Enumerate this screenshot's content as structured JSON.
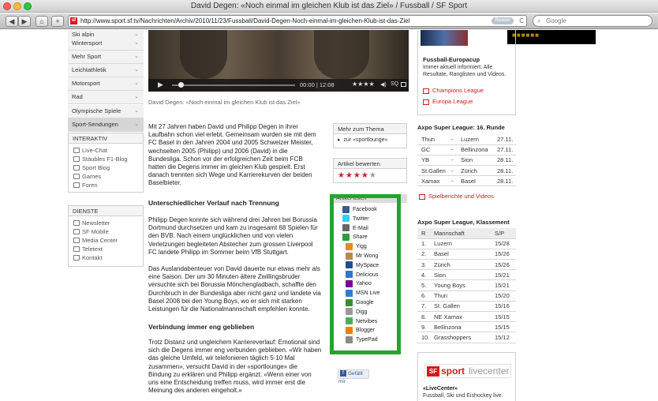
{
  "window": {
    "title": "David Degen: «Noch einmal im gleichen Klub ist das Ziel» / Fussball / SF Sport"
  },
  "toolbar": {
    "back_label": "◀",
    "forward_label": "▶",
    "home_label": "⌂",
    "add_label": "+",
    "url": "http://www.sport.sf.tv/Nachrichten/Archiv/2010/11/23/Fussball/David-Degen-Noch-einmal-im-gleichen-Klub-ist-das-Ziel",
    "reader_label": "Reader",
    "reload_label": "C",
    "search_placeholder": "Google"
  },
  "sidebar": {
    "sports": [
      "Ski alpin",
      "Wintersport",
      "Mehr Sport",
      "Leichtathletik",
      "Motorsport",
      "Rad",
      "Olympische Spiele",
      "Sport-Sendungen"
    ],
    "interaktiv_title": "INTERAKTIV",
    "interaktiv": [
      {
        "label": "Live-Chat",
        "icon": "chat-icon"
      },
      {
        "label": "Stäubles F1-Blog",
        "icon": "blog-icon"
      },
      {
        "label": "Sport Blog",
        "icon": "blog-icon"
      },
      {
        "label": "Games",
        "icon": "games-icon"
      },
      {
        "label": "Foren",
        "icon": "forum-icon"
      }
    ],
    "dienste_title": "DIENSTE",
    "dienste": [
      {
        "label": "Newsletter",
        "icon": "newsletter-icon"
      },
      {
        "label": "SF Mobile",
        "icon": "mobile-icon"
      },
      {
        "label": "Media Center",
        "icon": "media-icon"
      },
      {
        "label": "Teletext",
        "icon": "teletext-icon"
      },
      {
        "label": "Kontakt",
        "icon": "mail-icon"
      }
    ]
  },
  "video": {
    "time": "00:00 | 12:08",
    "rating": "★★★★",
    "sq_label": "SQ",
    "caption": "David Degen: «Noch einmal im gleichen Klub ist das Ziel»"
  },
  "article": {
    "p1": "Mit 27 Jahren haben David und Philipp Degen in ihrer Laufbahn schon viel erlebt. Gemeinsam wurden sie mit dem FC Basel in den Jahren 2004 und 2005 Schweizer Meister, wechselten 2005 (Philipp) und 2006 (David) in die Bundesliga. Schon vor der erfolgreichen Zeit beim FCB hatten die Degens immer im gleichen Klub gespielt. Erst danach trennten sich Wege und Karrierekurven der beiden Baselbieter.",
    "h2a": "Unterschiedlicher Verlauf nach Trennung",
    "p2": "Philipp Degen konnte sich während drei Jahren bei Borussia Dortmund durchsetzen und kam zu insgesamt 68 Spielen für den BVB. Nach einem unglücklichen und von vielen Verletzungen begleiteten Abstecher zum grossen Liverpool FC landete Philipp im Sommer beim VfB Stuttgart.",
    "p3": "Das Auslandabenteuer von David dauerte nur etwas mehr als eine Saison. Der um 30 Minuten ältere Zwillingsbruder versuchte sich bei Borussia Mönchengladbach, schaffte den Durchbruch in der Bundesliga aber nicht ganz und landete via Basel 2008 bei den Young Boys, wo er sich mit starken Leistungen für die Nationalmannschaft empfehlen konnte.",
    "h2b": "Verbindung immer eng geblieben",
    "p4": "Trotz Distanz und ungleichem Karriereverlauf: Emotional sind sich die Degens immer eng verbunden geblieben. «Wir haben das gleiche Umfeld, wir telefonieren täglich 5-10 Mal zusammen», versucht David in der «sportlounge» die Bindung zu erklären und Philipp ergänzt: «Wenn einer von uns eine Entscheidung treffen muss, wird immer erst die Meinung des anderen eingeholt.»"
  },
  "mid": {
    "thema_title": "Mehr zum Thema",
    "thema_link": "zur «sportlounge»",
    "bewerten_title": "Artikel bewerten",
    "stars": "★★★★",
    "star_empty": "★",
    "teilen_title": "Artikel teilen",
    "share": [
      {
        "label": "Facebook",
        "icon": "facebook-icon",
        "color": "#3b5998"
      },
      {
        "label": "Twitter",
        "icon": "twitter-icon",
        "color": "#33ccff"
      },
      {
        "label": "E-Mail",
        "icon": "email-icon",
        "color": "#666666"
      },
      {
        "label": "Share",
        "icon": "share-icon",
        "color": "#2a9d3a"
      },
      {
        "label": "Yigg",
        "icon": "yigg-icon",
        "color": "#e58a1f"
      },
      {
        "label": "Mr Wong",
        "icon": "mrwong-icon",
        "color": "#b38b4d"
      },
      {
        "label": "MySpace",
        "icon": "myspace-icon",
        "color": "#1d4f91"
      },
      {
        "label": "Delicious",
        "icon": "delicious-icon",
        "color": "#3274d1"
      },
      {
        "label": "Yahoo",
        "icon": "yahoo-icon",
        "color": "#7b0099"
      },
      {
        "label": "MSN Live",
        "icon": "msn-icon",
        "color": "#2a7fd4"
      },
      {
        "label": "Google",
        "icon": "google-icon",
        "color": "#3c8d2f"
      },
      {
        "label": "Digg",
        "icon": "digg-icon",
        "color": "#9a9a9a"
      },
      {
        "label": "Netvibes",
        "icon": "netvibes-icon",
        "color": "#4caf50"
      },
      {
        "label": "Blogger",
        "icon": "blogger-icon",
        "color": "#f57d00"
      },
      {
        "label": "TypePad",
        "icon": "typepad-icon",
        "color": "#8a8a8a"
      }
    ],
    "highlight_color": "#22a52a",
    "like_label": "Gefällt mir"
  },
  "right": {
    "europa_title": "Fussball-Europacup",
    "europa_text": "Immer aktuell informiert: Alle Resultate, Ranglisten und Videos.",
    "links": [
      "Champions League",
      "Europa League"
    ],
    "round_title": "Axpo Super League: 16. Runde",
    "fixtures": [
      {
        "home": "Thun",
        "sep": "-",
        "away": "Luzern",
        "date": "27.11."
      },
      {
        "home": "GC",
        "sep": "-",
        "away": "Bellinzona",
        "date": "27.11."
      },
      {
        "home": "YB",
        "sep": "-",
        "away": "Sion",
        "date": "28.11."
      },
      {
        "home": "St.Gallen",
        "sep": "-",
        "away": "Zürich",
        "date": "28.11."
      },
      {
        "home": "Xamax",
        "sep": "-",
        "away": "Basel",
        "date": "28.11."
      }
    ],
    "round_link": "Spielberichte und Videos",
    "table_title": "Axpo Super League, Klassement",
    "table_header": {
      "r": "R",
      "team": "Mannschaft",
      "sp": "S/P"
    },
    "table": [
      {
        "r": "1.",
        "team": "Luzern",
        "sp": "15/28"
      },
      {
        "r": "2.",
        "team": "Basel",
        "sp": "15/26"
      },
      {
        "r": "3.",
        "team": "Zürich",
        "sp": "15/26"
      },
      {
        "r": "4.",
        "team": "Sion",
        "sp": "15/21"
      },
      {
        "r": "5.",
        "team": "Young Boys",
        "sp": "15/21"
      },
      {
        "r": "6.",
        "team": "Thun",
        "sp": "15/20"
      },
      {
        "r": "7.",
        "team": "St. Gallen",
        "sp": "15/16"
      },
      {
        "r": "8.",
        "team": "NE Xamax",
        "sp": "15/15"
      },
      {
        "r": "9.",
        "team": "Bellinzona",
        "sp": "15/15"
      },
      {
        "r": "10.",
        "team": "Grasshoppers",
        "sp": "15/12"
      }
    ],
    "livecenter_sf": "SF",
    "livecenter_sport": "sport",
    "livecenter_live": "livecenter",
    "livecenter_title": "«LiveCenter»",
    "livecenter_text": "Fussball, Ski und Eishockey live."
  }
}
